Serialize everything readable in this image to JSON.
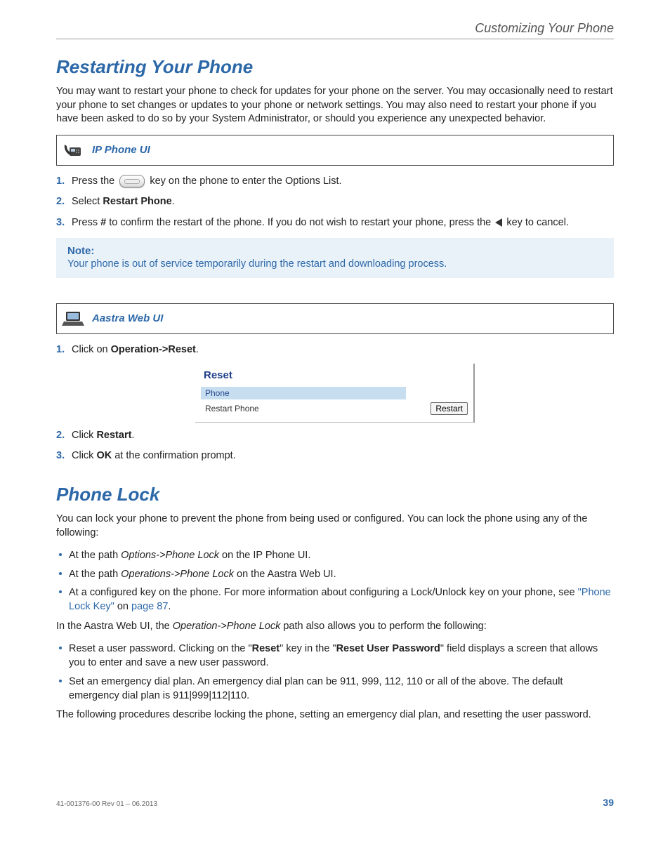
{
  "header": {
    "breadcrumb": "Customizing Your Phone"
  },
  "section1": {
    "title": "Restarting Your Phone",
    "intro": "You may want to restart your phone to check for updates for your phone on the server. You may occasionally need to restart your phone to set changes or updates to your phone or network settings.   You may also need to restart your phone if you have been asked to do so by your System Administrator, or should you experience any unexpected behavior."
  },
  "ip_phone_ui": {
    "label": "IP Phone UI",
    "step1_a": "Press the ",
    "step1_b": " key on the phone to enter the Options List.",
    "step2_a": "Select ",
    "step2_b": "Restart Phone",
    "step2_c": ".",
    "step3_a": "Press ",
    "step3_b": "#",
    "step3_c": " to confirm the restart of the phone. If you do not wish to restart your phone, press the ",
    "step3_d": " key to cancel."
  },
  "note": {
    "title": "Note:",
    "text": "Your phone is out of service temporarily during the restart and downloading process."
  },
  "web_ui": {
    "label": "Aastra Web UI",
    "step1_a": "Click on ",
    "step1_b": "Operation->Reset",
    "step1_c": ".",
    "figure": {
      "heading": "Reset",
      "bar": "Phone",
      "row_label": "Restart Phone",
      "button": "Restart"
    },
    "step2_a": "Click ",
    "step2_b": "Restart",
    "step2_c": ".",
    "step3_a": "Click ",
    "step3_b": "OK",
    "step3_c": " at the confirmation prompt."
  },
  "section2": {
    "title": "Phone Lock",
    "intro": "You can lock your phone to prevent the phone from being used or configured. You can lock the phone using any of the following:",
    "b1_a": "At the path ",
    "b1_b": "Options->Phone Lock",
    "b1_c": " on the IP Phone UI.",
    "b2_a": "At the path ",
    "b2_b": "Operations->Phone Lock",
    "b2_c": " on the Aastra Web UI.",
    "b3_a": "At a configured key on the phone. For more information about configuring a Lock/Unlock key on your phone, see ",
    "b3_link1": "\"Phone Lock Key\"",
    "b3_mid": " on ",
    "b3_link2": "page 87",
    "b3_end": ".",
    "para2_a": "In the Aastra Web UI, the ",
    "para2_b": "Operation->Phone Lock",
    "para2_c": " path also allows you to perform the following:",
    "b4_a": "Reset a user password. Clicking on the \"",
    "b4_b": "Reset",
    "b4_c": "\" key in the \"",
    "b4_d": "Reset User Password",
    "b4_e": "\" field displays a screen that allows you to enter and save a new user password.",
    "b5": "Set an emergency dial plan. An emergency dial plan can be 911, 999, 112, 110 or all of the above. The default emergency dial plan is 911|999|112|110.",
    "para3": "The following procedures describe locking the phone, setting an emergency dial plan, and resetting the user password."
  },
  "footer": {
    "docref": "41-001376-00 Rev 01 – 06.2013",
    "page": "39"
  },
  "nums": {
    "n1": "1.",
    "n2": "2.",
    "n3": "3."
  }
}
